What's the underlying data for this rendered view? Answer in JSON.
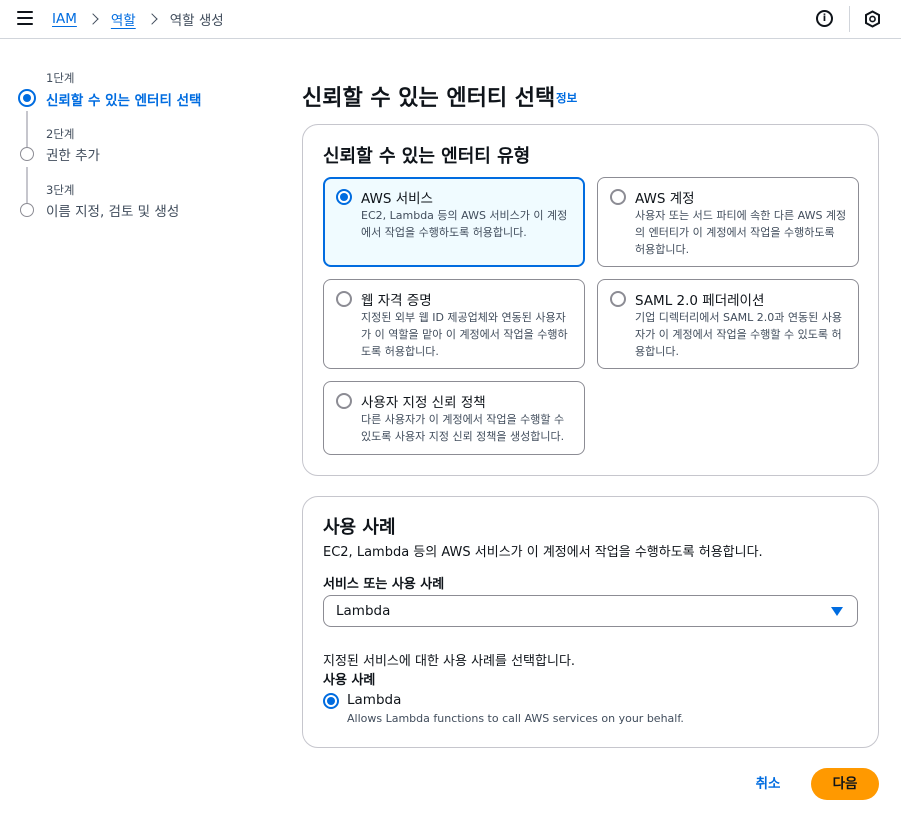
{
  "breadcrumb": {
    "items": [
      "IAM",
      "역할"
    ],
    "current": "역할 생성"
  },
  "header": {
    "info_icon_glyph": "i"
  },
  "steps": [
    {
      "num": "1단계",
      "title": "신뢰할 수 있는 엔터티 선택",
      "state": "active"
    },
    {
      "num": "2단계",
      "title": "권한 추가",
      "state": "pending"
    },
    {
      "num": "3단계",
      "title": "이름 지정, 검토 및 생성",
      "state": "pending"
    }
  ],
  "page": {
    "title": "신뢰할 수 있는 엔터티 선택",
    "info_link": "정보"
  },
  "entity_type": {
    "title": "신뢰할 수 있는 엔터티 유형",
    "options": [
      {
        "title": "AWS 서비스",
        "desc": "EC2, Lambda 등의 AWS 서비스가 이 계정에서 작업을 수행하도록 허용합니다.",
        "selected": true
      },
      {
        "title": "AWS 계정",
        "desc": "사용자 또는 서드 파티에 속한 다른 AWS 계정의 엔터티가 이 계정에서 작업을 수행하도록 허용합니다.",
        "selected": false
      },
      {
        "title": "웹 자격 증명",
        "desc": "지정된 외부 웹 ID 제공업체와 연동된 사용자가 이 역할을 맡아 이 계정에서 작업을 수행하도록 허용합니다.",
        "selected": false
      },
      {
        "title": "SAML 2.0 페더레이션",
        "desc": "기업 디렉터리에서 SAML 2.0과 연동된 사용자가 이 계정에서 작업을 수행할 수 있도록 허용합니다.",
        "selected": false
      },
      {
        "title": "사용자 지정 신뢰 정책",
        "desc": "다른 사용자가 이 계정에서 작업을 수행할 수 있도록 사용자 지정 신뢰 정책을 생성합니다.",
        "selected": false
      }
    ]
  },
  "use_case": {
    "title": "사용 사례",
    "description": "EC2, Lambda 등의 AWS 서비스가 이 계정에서 작업을 수행하도록 허용합니다.",
    "select_label": "서비스 또는 사용 사례",
    "select_value": "Lambda",
    "hint": "지정된 서비스에 대한 사용 사례를 선택합니다.",
    "radio_label": "사용 사례",
    "option_title": "Lambda",
    "option_desc": "Allows Lambda functions to call AWS services on your behalf."
  },
  "footer": {
    "cancel": "취소",
    "next": "다음"
  },
  "colors": {
    "accent": "#006ce0",
    "primary_button": "#ff9900",
    "selected_tile_bg": "#f0fbff"
  }
}
